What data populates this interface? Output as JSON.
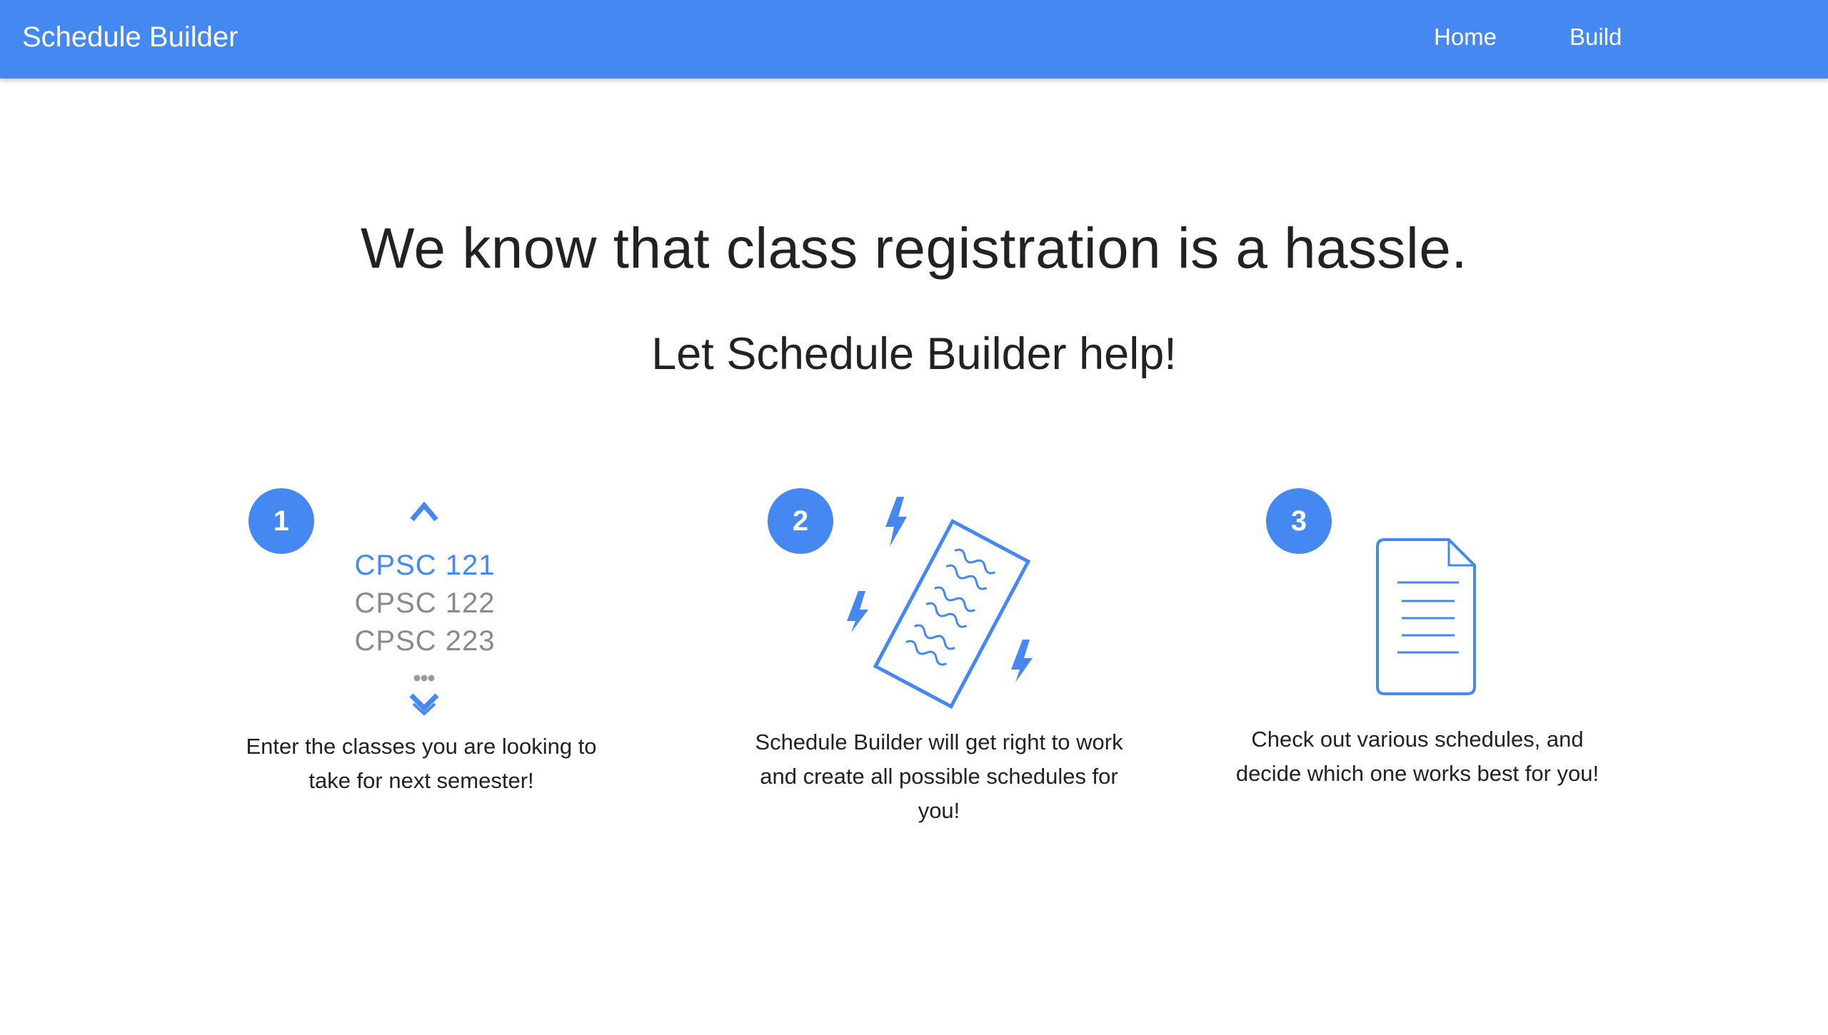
{
  "navbar": {
    "brand": "Schedule Builder",
    "links": [
      {
        "label": "Home"
      },
      {
        "label": "Build"
      }
    ],
    "background": "#4688f1"
  },
  "hero": {
    "headline": "We know that class registration is a hassle.",
    "subheadline": "Let Schedule Builder help!"
  },
  "steps": [
    {
      "number": "1",
      "icon": "course-list-scroll-icon",
      "courses": [
        "CPSC 121",
        "CPSC 122",
        "CPSC 223"
      ],
      "caption": "Enter the classes you are looking to take for next semester!"
    },
    {
      "number": "2",
      "icon": "schedule-generating-icon",
      "caption": "Schedule Builder will get right to work and create all possible schedules for you!"
    },
    {
      "number": "3",
      "icon": "document-icon",
      "caption": "Check out various schedules, and decide which one works best for you!"
    }
  ],
  "colors": {
    "accent": "#4688f1",
    "text": "#222222",
    "muted": "#8a8a8a"
  }
}
